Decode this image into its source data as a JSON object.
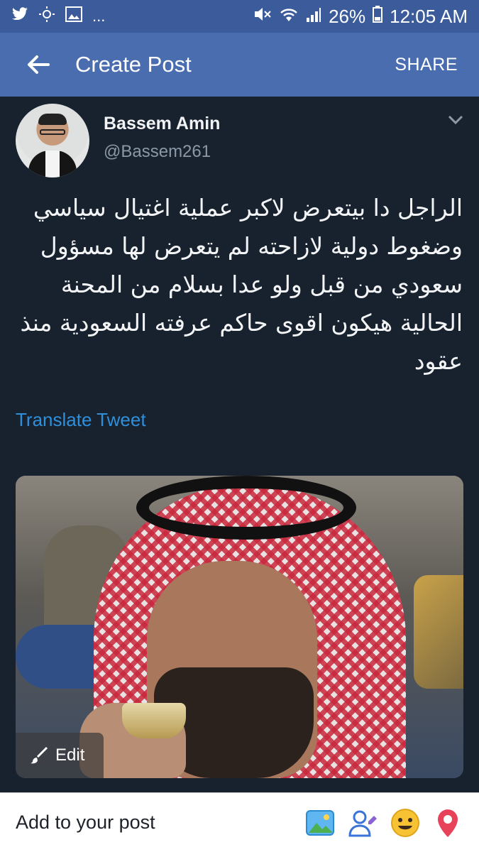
{
  "status_bar": {
    "left_icons": [
      "twitter-icon",
      "sun-settings-icon",
      "image-icon"
    ],
    "ellipsis": "...",
    "right_icons": [
      "mute-icon",
      "wifi-icon",
      "signal-icon",
      "battery-icon"
    ],
    "battery": "26%",
    "time": "12:05 AM"
  },
  "app_bar": {
    "title": "Create Post",
    "share_label": "SHARE"
  },
  "tweet": {
    "user_name": "Bassem Amin",
    "handle": "@Bassem261",
    "text": "الراجل دا بيتعرض لاكبر عملية اغتيال سياسي وضغوط دولية لازاحته لم يتعرض لها مسؤول سعودي من قبل ولو عدا بسلام من المحنة الحالية هيكون اقوى حاكم عرفته السعودية منذ عقود",
    "translate_label": "Translate Tweet",
    "edit_label": "Edit"
  },
  "bottom_bar": {
    "add_label": "Add to your post",
    "icons": [
      "photo-icon",
      "tag-people-icon",
      "feeling-icon",
      "location-icon"
    ]
  },
  "colors": {
    "app_bar": "#4a6db0",
    "status_bar": "#3b5b9b",
    "tweet_bg": "#18222f",
    "link": "#2f8fdb"
  }
}
